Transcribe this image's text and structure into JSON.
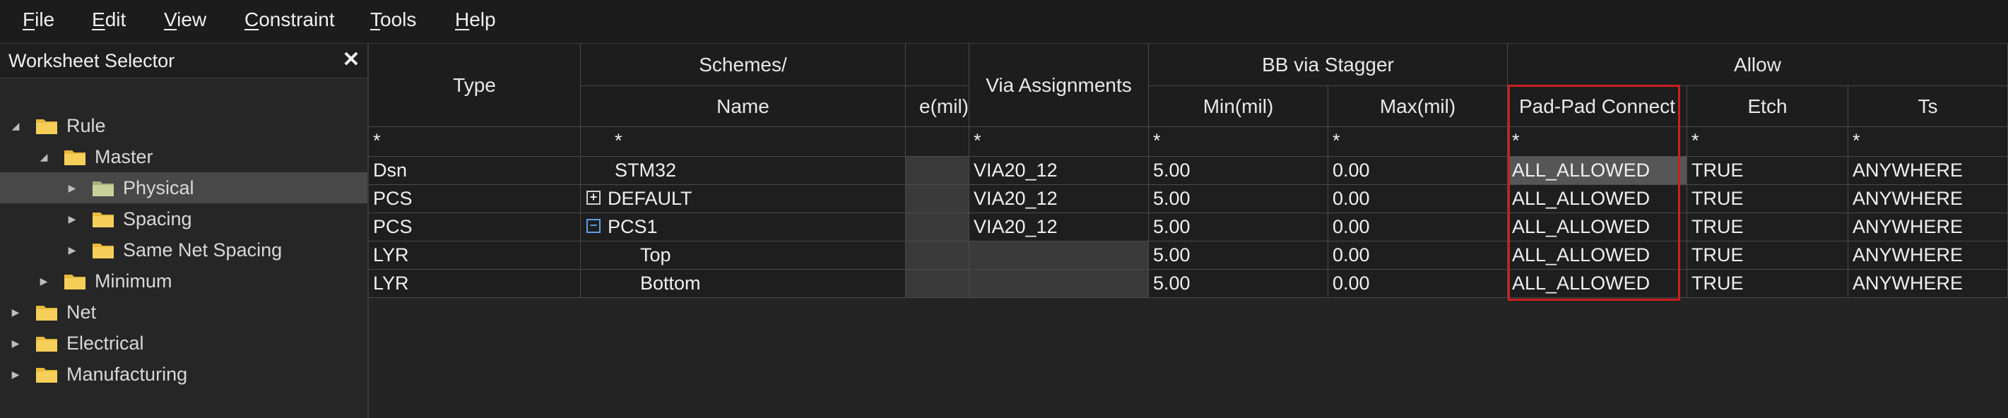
{
  "menu": [
    {
      "key": "F",
      "rest": "ile"
    },
    {
      "key": "E",
      "rest": "dit"
    },
    {
      "key": "V",
      "rest": "iew"
    },
    {
      "key": "C",
      "rest": "onstraint"
    },
    {
      "key": "T",
      "rest": "ools"
    },
    {
      "key": "H",
      "rest": "elp"
    }
  ],
  "sidebar": {
    "title": "Worksheet Selector",
    "close_glyph": "✕",
    "items": [
      {
        "label": "Rule",
        "arrow": "◢"
      },
      {
        "label": "Master",
        "arrow": "◢"
      },
      {
        "label": "Physical",
        "arrow": "▶"
      },
      {
        "label": "Spacing",
        "arrow": "▶"
      },
      {
        "label": "Same Net Spacing",
        "arrow": "▶"
      },
      {
        "label": "Minimum",
        "arrow": "▶"
      },
      {
        "label": "Net",
        "arrow": "▶"
      },
      {
        "label": "Electrical",
        "arrow": "▶"
      },
      {
        "label": "Manufacturing",
        "arrow": "▶"
      }
    ]
  },
  "grid": {
    "headers": {
      "type": "Type",
      "schemes": "Schemes/",
      "name": "Name",
      "width": "e(mil)",
      "via_assignments": "Via Assignments",
      "bb_via_stagger": "BB via Stagger",
      "min": "Min(mil)",
      "max": "Max(mil)",
      "allow": "Allow",
      "pad_pad": "Pad-Pad Connect",
      "etch": "Etch",
      "ts": "Ts"
    },
    "filter": "*",
    "rows": [
      {
        "type": "Dsn",
        "name": "STM32",
        "expander": "",
        "via": "VIA20_12",
        "min": "5.00",
        "max": "0.00",
        "pad": "ALL_ALLOWED",
        "etch": "TRUE",
        "ts": "ANYWHERE"
      },
      {
        "type": "PCS",
        "name": "DEFAULT",
        "expander": "+",
        "via": "VIA20_12",
        "min": "5.00",
        "max": "0.00",
        "pad": "ALL_ALLOWED",
        "etch": "TRUE",
        "ts": "ANYWHERE"
      },
      {
        "type": "PCS",
        "name": "PCS1",
        "expander": "−",
        "via": "VIA20_12",
        "min": "5.00",
        "max": "0.00",
        "pad": "ALL_ALLOWED",
        "etch": "TRUE",
        "ts": "ANYWHERE"
      },
      {
        "type": "LYR",
        "name": "Top",
        "expander": "",
        "via": "",
        "min": "5.00",
        "max": "0.00",
        "pad": "ALL_ALLOWED",
        "etch": "TRUE",
        "ts": "ANYWHERE"
      },
      {
        "type": "LYR",
        "name": "Bottom",
        "expander": "",
        "via": "",
        "min": "5.00",
        "max": "0.00",
        "pad": "ALL_ALLOWED",
        "etch": "TRUE",
        "ts": "ANYWHERE"
      }
    ]
  },
  "colors": {
    "highlight_border": "#cc1f1f",
    "folder": "#f2c94c",
    "selected_row": "#484848"
  }
}
